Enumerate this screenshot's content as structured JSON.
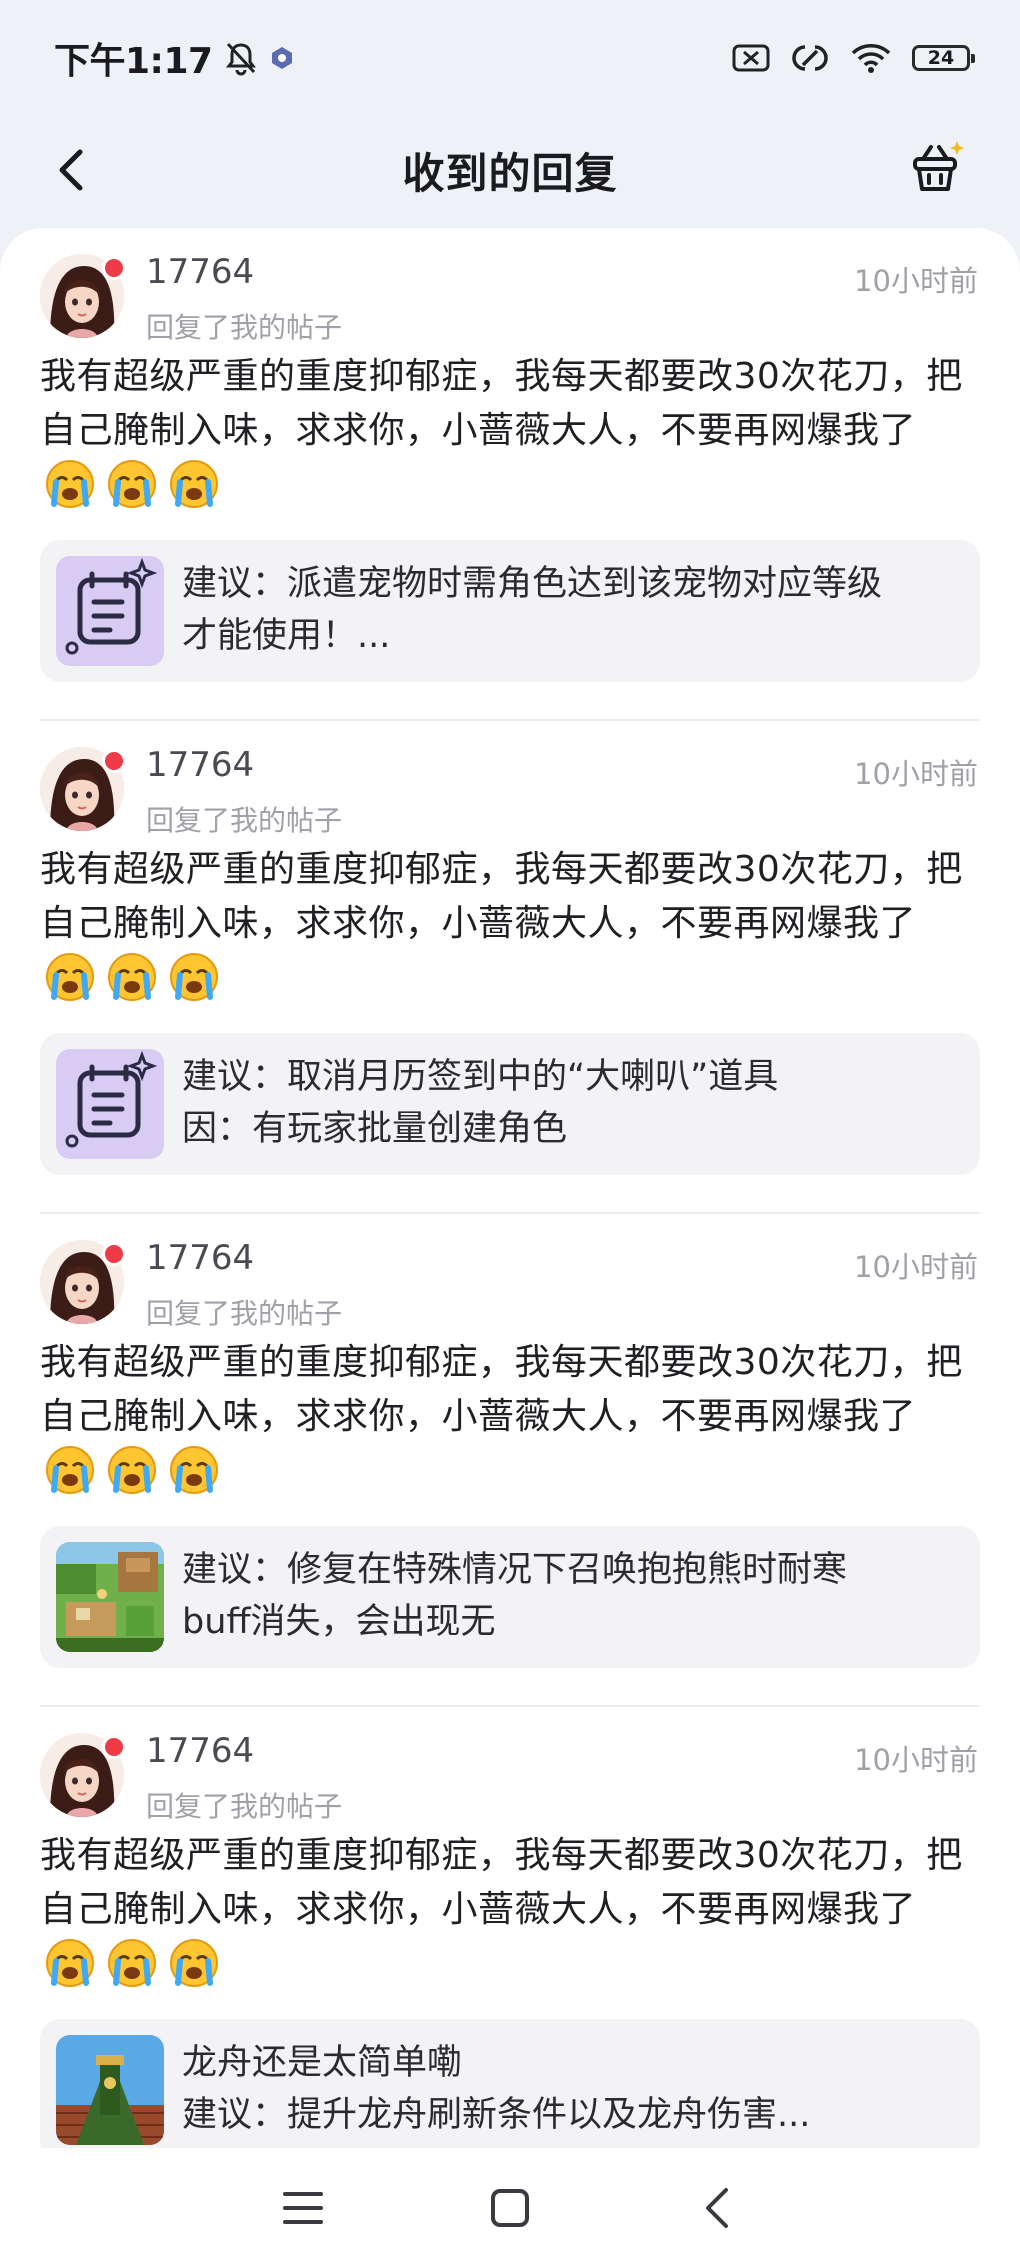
{
  "status_bar": {
    "time": "下午1:17",
    "battery": "24",
    "icons": [
      "mute-bell-icon",
      "app-notification-icon",
      "sim-off-icon",
      "hd-link-icon",
      "wifi-icon",
      "battery-icon"
    ]
  },
  "header": {
    "title": "收到的回复",
    "back_icon": "chevron-left-icon",
    "shop_icon": "shopping-basket-icon"
  },
  "replies": [
    {
      "username": "17764",
      "subtitle": "回复了我的帖子",
      "time": "10小时前",
      "content": "我有超级严重的重度抑郁症，我每天都要改30次花刀，把自己腌制入味，求求你，小蔷薇大人，不要再网爆我了",
      "emoji": [
        "crying-face",
        "crying-face",
        "crying-face"
      ],
      "quote": {
        "thumb": "suggestion-note-icon",
        "line1": "建议：派遣宠物时需角色达到该宠物对应等级",
        "line2": "才能使用！..."
      }
    },
    {
      "username": "17764",
      "subtitle": "回复了我的帖子",
      "time": "10小时前",
      "content": "我有超级严重的重度抑郁症，我每天都要改30次花刀，把自己腌制入味，求求你，小蔷薇大人，不要再网爆我了",
      "emoji": [
        "crying-face",
        "crying-face",
        "crying-face"
      ],
      "quote": {
        "thumb": "suggestion-note-icon",
        "line1": "建议：取消月历签到中的“大喇叭”道具",
        "line2": "因：有玩家批量创建角色"
      }
    },
    {
      "username": "17764",
      "subtitle": "回复了我的帖子",
      "time": "10小时前",
      "content": "我有超级严重的重度抑郁症，我每天都要改30次花刀，把自己腌制入味，求求你，小蔷薇大人，不要再网爆我了",
      "emoji": [
        "crying-face",
        "crying-face",
        "crying-face"
      ],
      "quote": {
        "thumb": "game-screenshot-thumb",
        "line1": "建议：修复在特殊情况下召唤抱抱熊时耐寒",
        "line2": "buff消失，会出现无"
      }
    },
    {
      "username": "17764",
      "subtitle": "回复了我的帖子",
      "time": "10小时前",
      "content": "我有超级严重的重度抑郁症，我每天都要改30次花刀，把自己腌制入味，求求你，小蔷薇大人，不要再网爆我了",
      "emoji": [
        "crying-face",
        "crying-face",
        "crying-face"
      ],
      "quote": {
        "thumb": "dragon-boat-thumb",
        "line1": "龙舟还是太简单嘞",
        "line2": "建议：提升龙舟刷新条件以及龙舟伤害..."
      }
    }
  ],
  "nav_bar": {
    "icons": [
      "menu-icon",
      "home-icon",
      "back-icon"
    ]
  }
}
